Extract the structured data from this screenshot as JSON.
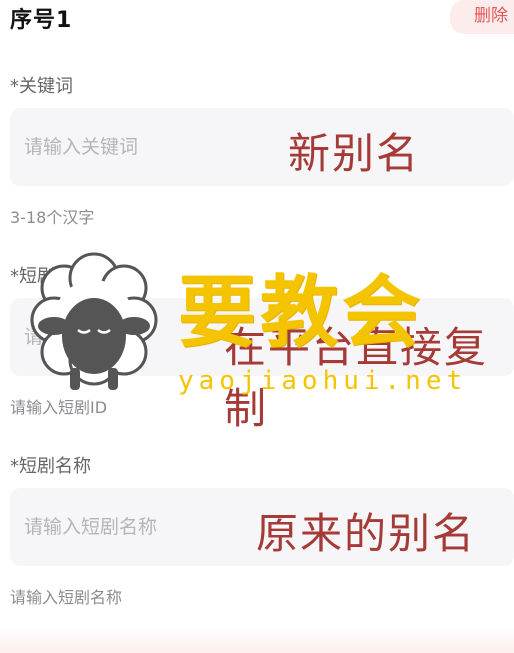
{
  "header": {
    "title": "序号1",
    "delete_label": "删除"
  },
  "fields": [
    {
      "label": "*关键词",
      "placeholder": "请输入关键词",
      "hint": "3-18个汉字",
      "annotation": "新别名"
    },
    {
      "label": "*短剧ID",
      "placeholder": "请输入短剧ID",
      "hint": "请输入短剧ID",
      "annotation": "在平台直接复制"
    },
    {
      "label": "*短剧名称",
      "placeholder": "请输入短剧名称",
      "hint": "请输入短剧名称",
      "annotation": "原来的别名"
    }
  ],
  "watermark": {
    "text": "要教会",
    "url": "yaojiaohui.net"
  },
  "colors": {
    "annotation": "#a53a37",
    "watermark": "#f5c400",
    "delete": "#e25757"
  }
}
